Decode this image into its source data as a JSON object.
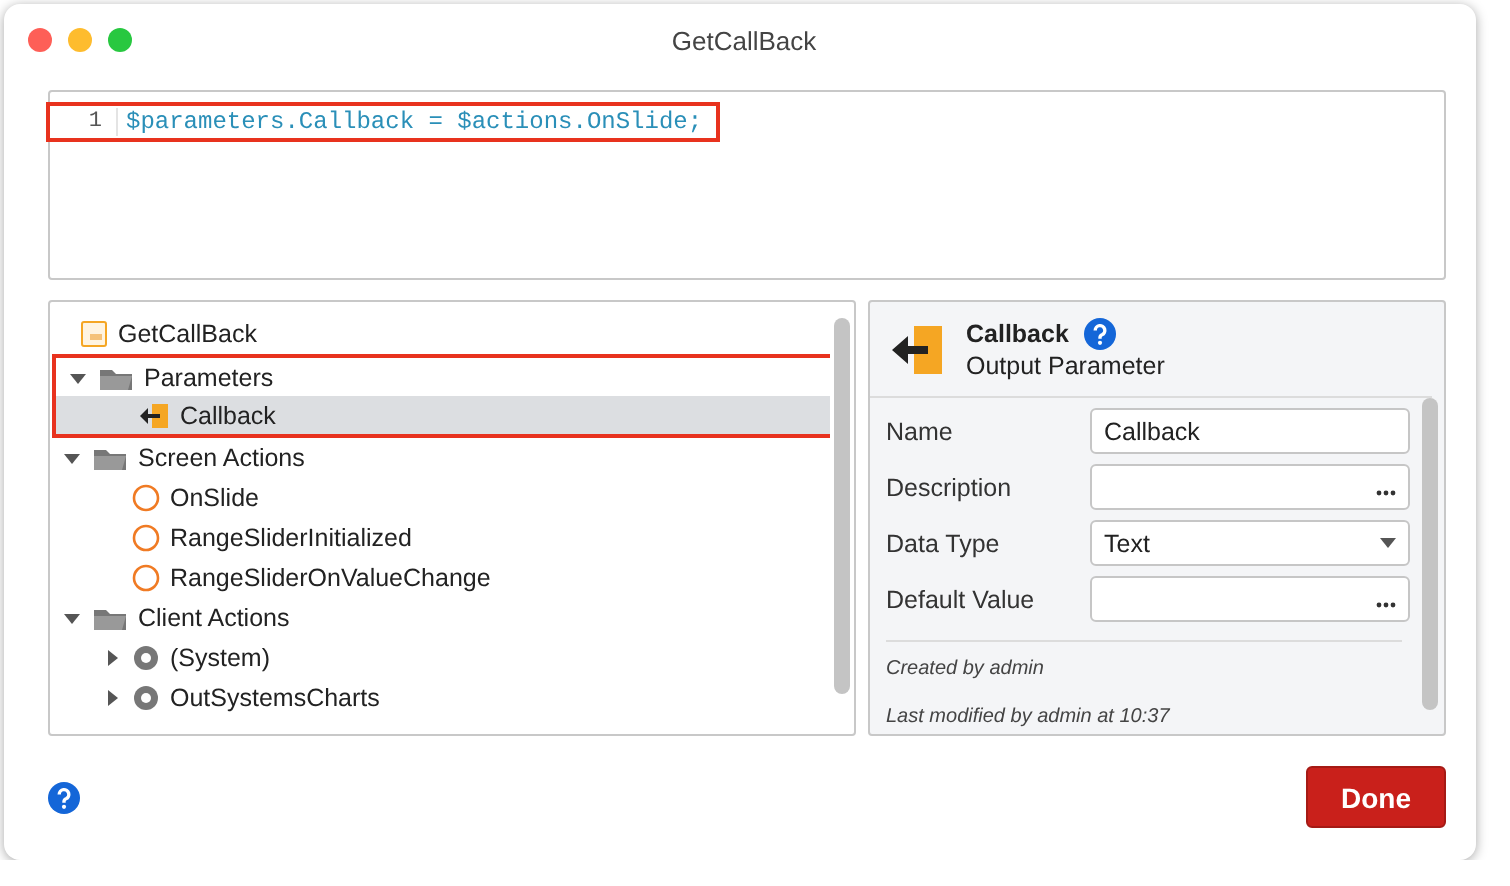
{
  "window": {
    "title": "GetCallBack"
  },
  "editor": {
    "lines": [
      {
        "number": "1",
        "code": "$parameters.Callback = $actions.OnSlide;",
        "highlighted": true
      }
    ]
  },
  "tree": {
    "items": [
      {
        "label": "GetCallBack",
        "kind": "script",
        "selected": false,
        "children": [
          {
            "label": "Parameters",
            "kind": "folder",
            "expanded": true,
            "highlighted": true,
            "selected": false,
            "children": [
              {
                "label": "Callback",
                "kind": "output",
                "selected": true
              }
            ]
          },
          {
            "label": "Screen Actions",
            "kind": "folder",
            "expanded": true,
            "selected": false,
            "children": [
              {
                "label": "OnSlide",
                "kind": "action",
                "selected": false
              },
              {
                "label": "RangeSliderInitialized",
                "kind": "action",
                "selected": false
              },
              {
                "label": "RangeSliderOnValueChange",
                "kind": "action",
                "selected": false
              }
            ]
          },
          {
            "label": "Client Actions",
            "kind": "folder",
            "expanded": true,
            "selected": false,
            "children": [
              {
                "label": "(System)",
                "kind": "module",
                "expanded": false,
                "selected": false
              },
              {
                "label": "OutSystemsCharts",
                "kind": "module",
                "expanded": false,
                "selected": false
              }
            ]
          }
        ]
      }
    ]
  },
  "properties": {
    "title": "Callback",
    "subtitle": "Output Parameter",
    "fields": [
      {
        "label": "Name",
        "kind": "text",
        "value": "Callback"
      },
      {
        "label": "Description",
        "kind": "ellipsis"
      },
      {
        "label": "Data Type",
        "kind": "dropdown",
        "value": "Text"
      },
      {
        "label": "Default Value",
        "kind": "ellipsis"
      }
    ],
    "notes": [
      "Created by admin",
      "Last modified by admin at 10:37"
    ]
  },
  "buttons": [
    {
      "label": "Done"
    }
  ]
}
